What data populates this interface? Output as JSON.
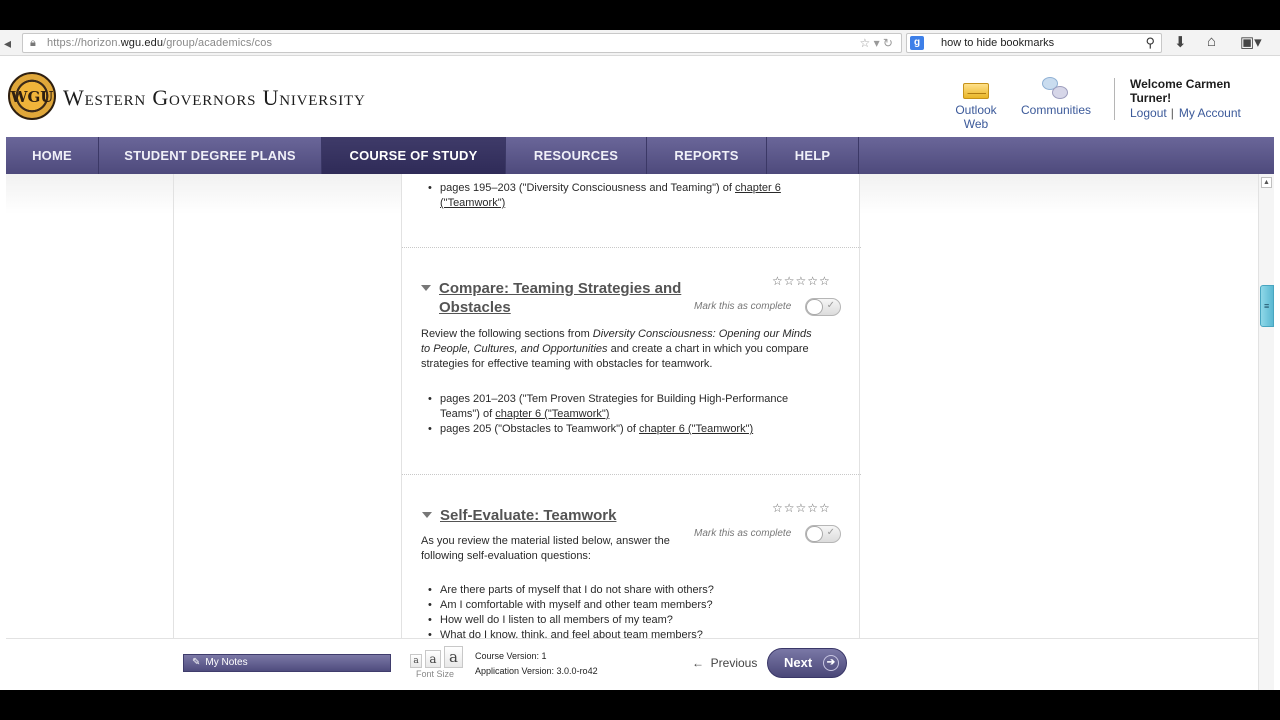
{
  "browser": {
    "url_prefix": "https://horizon.",
    "url_domain": "wgu.edu",
    "url_path": "/group/academics/cos",
    "search_query": "how to hide bookmarks"
  },
  "header": {
    "logo_initials": "WGU",
    "logo_text": "Western Governors University",
    "outlook_label": "Outlook Web",
    "communities_label": "Communities",
    "welcome": "Welcome Carmen Turner!",
    "logout": "Logout",
    "separator": "|",
    "my_account": "My Account"
  },
  "nav": {
    "items": [
      {
        "label": "HOME"
      },
      {
        "label": "STUDENT DEGREE PLANS"
      },
      {
        "label": "COURSE OF STUDY"
      },
      {
        "label": "RESOURCES"
      },
      {
        "label": "REPORTS"
      },
      {
        "label": "HELP"
      }
    ]
  },
  "content": {
    "top_item": {
      "text": "pages 195–203 (\"Diversity Consciousness and Teaming\") of ",
      "link_line1": "chapter 6",
      "link_line2": "(\"Teamwork\")"
    },
    "section1": {
      "title_line1": "Compare: Teaming Strategies and",
      "title_line2": "Obstacles",
      "stars": "☆☆☆☆☆",
      "mark_label": "Mark this as complete",
      "para_line1_pre": "Review the following sections from ",
      "para_line1_em": "Diversity Consciousness: Opening our Minds",
      "para_line2_em": "to People, Cultures, and Opportunities",
      "para_line2_post": " and create a chart in which you compare",
      "para_line3": "strategies for effective teaming with obstacles for teamwork.",
      "item1_line1": "pages 201–203 (\"Tem Proven Strategies for Building High-Performance",
      "item1_line2_pre": "Teams\") of ",
      "item1_link": "chapter 6 (\"Teamwork\")",
      "item2_pre": "pages 205 (\"Obstacles to Teamwork\") of ",
      "item2_link": "chapter 6 (\"Teamwork\")"
    },
    "section2": {
      "title": "Self-Evaluate: Teamwork",
      "stars": "☆☆☆☆☆",
      "mark_label": "Mark this as complete",
      "para_line1": "As you review the material listed below, answer the",
      "para_line2": "following self-evaluation questions:",
      "questions": [
        "Are there parts of myself that I do not share with others?",
        "Am I comfortable with myself and other team members?",
        "How well do I listen to all members of my team?",
        "What do I know, think, and feel about team members?"
      ]
    }
  },
  "footer": {
    "my_notes": "My Notes",
    "font_small": "a",
    "font_medium": "a",
    "font_large": "a",
    "font_size_label": "Font Size",
    "course_version": "Course Version: 1",
    "app_version": "Application Version: 3.0.0-ro42",
    "previous": "Previous",
    "next": "Next"
  },
  "colors": {
    "nav_bg": "#5a5688",
    "nav_active": "#36325f",
    "link": "#3c5a9a"
  }
}
